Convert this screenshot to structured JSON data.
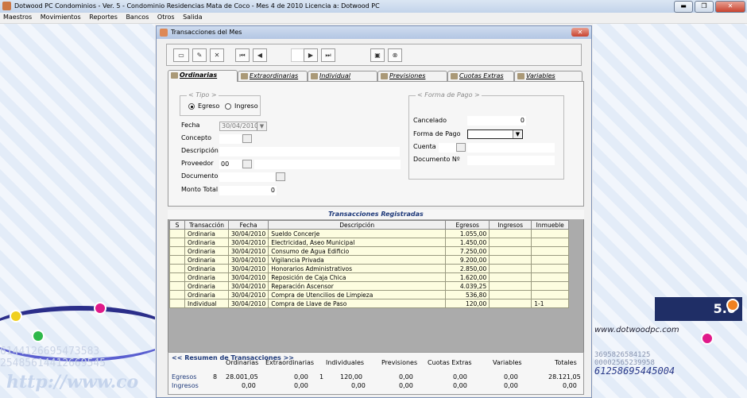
{
  "app": {
    "title": "Dotwood PC Condominios - Ver. 5  - Condominio Residencias Mata de Coco  - Mes 4 de 2010     Licencia a: Dotwood PC",
    "window_buttons": {
      "minimize": "▬",
      "maximize": "❐",
      "close": "✕"
    }
  },
  "menu": [
    "Maestros",
    "Movimientos",
    "Reportes",
    "Bancos",
    "Otros",
    "Salida"
  ],
  "background": {
    "version": "5.0",
    "right_url": "www.dotwoodpc.com",
    "left_url": "http://www.co",
    "left_numbers_1": "6144126695473583",
    "left_numbers_2": "25485614412669545",
    "right_numbers_1": "3695826584125",
    "right_numbers_2": "00002565239958",
    "right_numbers_3": "61258695445004"
  },
  "window": {
    "title": "Transacciones del Mes",
    "close": "✕"
  },
  "toolbar": {
    "new_icon": "▭",
    "edit_icon": "✎",
    "delete_icon": "✕",
    "first_icon": "⏮",
    "prev_icon": "◀",
    "next_icon": "▶",
    "last_icon": "⏭",
    "save_icon": "▣",
    "cancel_icon": "⊗"
  },
  "tabs": [
    "Ordinarias",
    "Extraordinarias",
    "Individual",
    "Previsiones",
    "Cuotas Extras",
    "Variables"
  ],
  "form": {
    "tipo_legend": "< Tipo >",
    "egreso": "Egreso",
    "ingreso": "Ingreso",
    "fecha_label": "Fecha",
    "fecha_value": "30/04/2010",
    "concepto_label": "Concepto",
    "descripcion_label": "Descripción",
    "proveedor_label": "Proveedor",
    "proveedor_value": "00",
    "documento_label": "Documento",
    "monto_label": "Monto Total",
    "monto_value": "0",
    "pago_legend": "< Forma de Pago >",
    "cancelado_label": "Cancelado",
    "cancelado_value": "0",
    "forma_label": "Forma de Pago",
    "cuenta_label": "Cuenta",
    "docnum_label": "Documento Nº"
  },
  "grid": {
    "title": "Transacciones Registradas",
    "headers": [
      "S",
      "Transacción",
      "Fecha",
      "Descripción",
      "Egresos",
      "Ingresos",
      "Inmueble"
    ],
    "rows": [
      [
        "",
        "Ordinaria",
        "30/04/2010",
        "Sueldo Concerje",
        "1.055,00",
        "",
        ""
      ],
      [
        "",
        "Ordinaria",
        "30/04/2010",
        "Electricidad, Aseo Municipal",
        "1.450,00",
        "",
        ""
      ],
      [
        "",
        "Ordinaria",
        "30/04/2010",
        "Consumo de Agua Edificio",
        "7.250,00",
        "",
        ""
      ],
      [
        "",
        "Ordinaria",
        "30/04/2010",
        "Vigilancia Privada",
        "9.200,00",
        "",
        ""
      ],
      [
        "",
        "Ordinaria",
        "30/04/2010",
        "Honorarios Administrativos",
        "2.850,00",
        "",
        ""
      ],
      [
        "",
        "Ordinaria",
        "30/04/2010",
        "Reposición de Caja Chica",
        "1.620,00",
        "",
        ""
      ],
      [
        "",
        "Ordinaria",
        "30/04/2010",
        "Reparación Ascensor",
        "4.039,25",
        "",
        ""
      ],
      [
        "",
        "Ordinaria",
        "30/04/2010",
        "Compra de Utencilios de Limpieza",
        "536,80",
        "",
        ""
      ],
      [
        "",
        "Individual",
        "30/04/2010",
        "Compra de Llave de Paso",
        "120,00",
        "",
        "1-1"
      ]
    ]
  },
  "summary": {
    "title": "<< Resumen de Transacciones >>",
    "columns": [
      "Ordinarias",
      "Extraordinarias",
      "Individuales",
      "Previsiones",
      "Cuotas Extras",
      "Variables",
      "Totales"
    ],
    "egresos_label": "Egresos",
    "ingresos_label": "Ingresos",
    "egresos": {
      "ord_count": "8",
      "ord": "28.001,05",
      "extra": "0,00",
      "ind_count": "1",
      "ind": "120,00",
      "prev": "0,00",
      "cuotas": "0,00",
      "var": "0,00",
      "total": "28.121,05"
    },
    "ingresos": {
      "ord": "0,00",
      "extra": "0,00",
      "ind": "0,00",
      "prev": "0,00",
      "cuotas": "0,00",
      "var": "0,00",
      "total": "0,00"
    }
  }
}
